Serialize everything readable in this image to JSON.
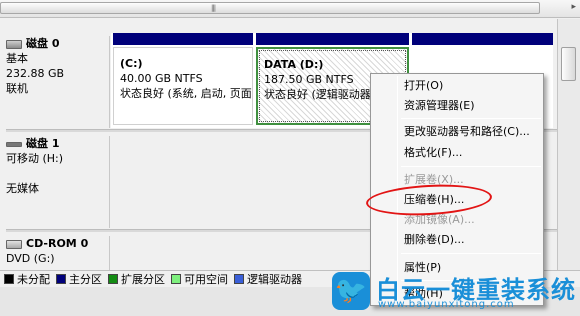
{
  "disks": [
    {
      "name": "磁盘 0",
      "type": "基本",
      "size": "232.88 GB",
      "status": "联机"
    },
    {
      "name": "磁盘 1",
      "type": "可移动 (H:)",
      "status": "无媒体"
    },
    {
      "name": "CD-ROM 0",
      "type": "DVD (G:)"
    }
  ],
  "partitions": {
    "c": {
      "name": "(C:)",
      "size": "40.00 GB NTFS",
      "status": "状态良好 (系统, 启动, 页面"
    },
    "d": {
      "name": "DATA  (D:)",
      "size": "187.50 GB NTFS",
      "status": "状态良好 (逻辑驱动器)"
    }
  },
  "legend": [
    {
      "label": "未分配",
      "color": "#000000"
    },
    {
      "label": "主分区",
      "color": "#00007a"
    },
    {
      "label": "扩展分区",
      "color": "#138b13"
    },
    {
      "label": "可用空间",
      "color": "#7ef07e"
    },
    {
      "label": "逻辑驱动器",
      "color": "#3a5fd8"
    }
  ],
  "context_menu": {
    "open": "打开(O)",
    "explorer": "资源管理器(E)",
    "change_letter": "更改驱动器号和路径(C)...",
    "format": "格式化(F)...",
    "extend": "扩展卷(X)...",
    "shrink": "压缩卷(H)...",
    "add_mirror": "添加镜像(A)...",
    "delete": "删除卷(D)...",
    "properties": "属性(P)",
    "help": "帮助(H)"
  },
  "watermark": {
    "brand": "白云一键重装系统",
    "url": "www.baiyunxitong.com"
  },
  "colors": {
    "primary_bar": "#00007a",
    "annotation": "#e21414",
    "watermark": "#1a8fd8"
  }
}
